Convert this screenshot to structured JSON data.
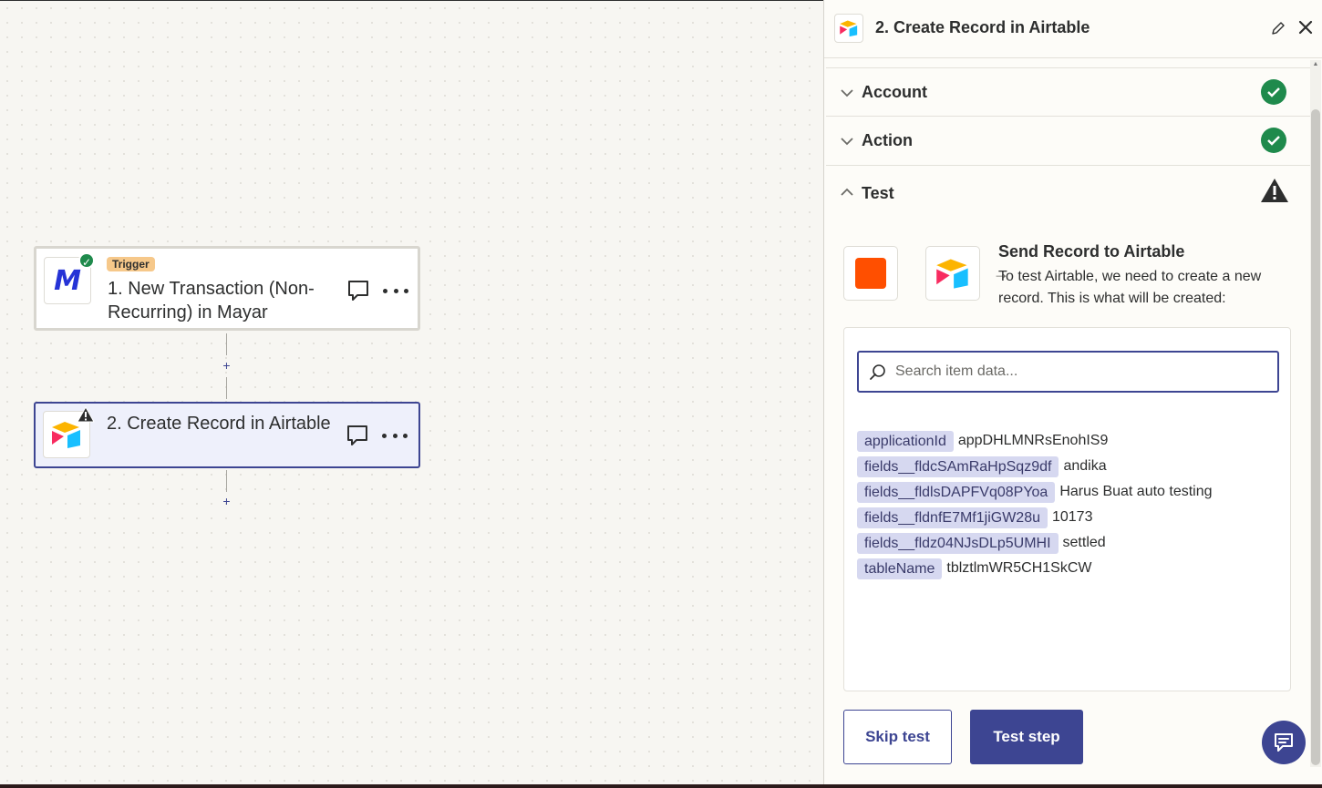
{
  "canvas": {
    "trigger_node": {
      "badge": "Trigger",
      "title": "1. New Transaction (Non-Recurring) in Mayar",
      "app_logo_letter": "M",
      "status": "check-icon"
    },
    "action_node": {
      "title": "2. Create Record in Airtable",
      "status": "warning-icon"
    },
    "plus_label": "+"
  },
  "panel": {
    "header": {
      "title": "2. Create Record in Airtable"
    },
    "sections": {
      "account": {
        "label": "Account",
        "status": "complete"
      },
      "action": {
        "label": "Action",
        "status": "complete"
      },
      "test": {
        "label": "Test",
        "status": "warning"
      }
    },
    "test": {
      "send_title": "Send Record to Airtable",
      "send_description": "To test Airtable, we need to create a new record. This is what will be created:",
      "arrow": "→",
      "search": {
        "placeholder": "Search item data...",
        "value": ""
      },
      "items": [
        {
          "key": "applicationId",
          "value": "appDHLMNRsEnohIS9"
        },
        {
          "key": "fields__fldcSAmRaHpSqz9df",
          "value": "andika"
        },
        {
          "key": "fields__fldlsDAPFVq08PYoa",
          "value": "Harus Buat auto testing"
        },
        {
          "key": "fields__fldnfE7Mf1jiGW28u",
          "value": "10173"
        },
        {
          "key": "fields__fldz04NJsDLp5UMHI",
          "value": "settled"
        },
        {
          "key": "tableName",
          "value": "tblztlmWR5CH1SkCW"
        }
      ]
    },
    "buttons": {
      "skip": "Skip test",
      "test": "Test step"
    }
  },
  "colors": {
    "accent": "#3d4592",
    "success": "#1f8a4c",
    "zapier_orange": "#ff4f00",
    "trigger_badge": "#f6c88a",
    "key_chip": "#d6d8f0"
  }
}
